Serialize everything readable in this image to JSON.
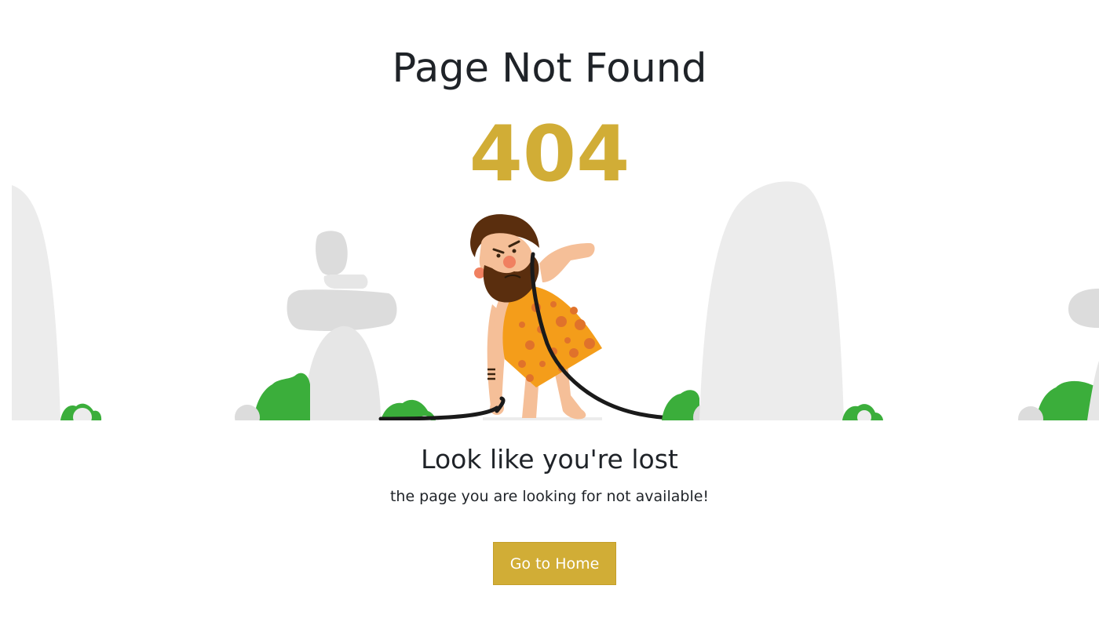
{
  "header": {
    "title": "Page Not Found",
    "code": "404"
  },
  "illustration": {
    "icon": "caveman-phone-illustration",
    "rock_color": "#ececec",
    "bush_color": "#3bae3b",
    "accent_color": "#d1ad36"
  },
  "body": {
    "subtitle": "Look like you're lost",
    "message": "the page you are looking for not available!"
  },
  "actions": {
    "home_label": "Go to Home"
  }
}
